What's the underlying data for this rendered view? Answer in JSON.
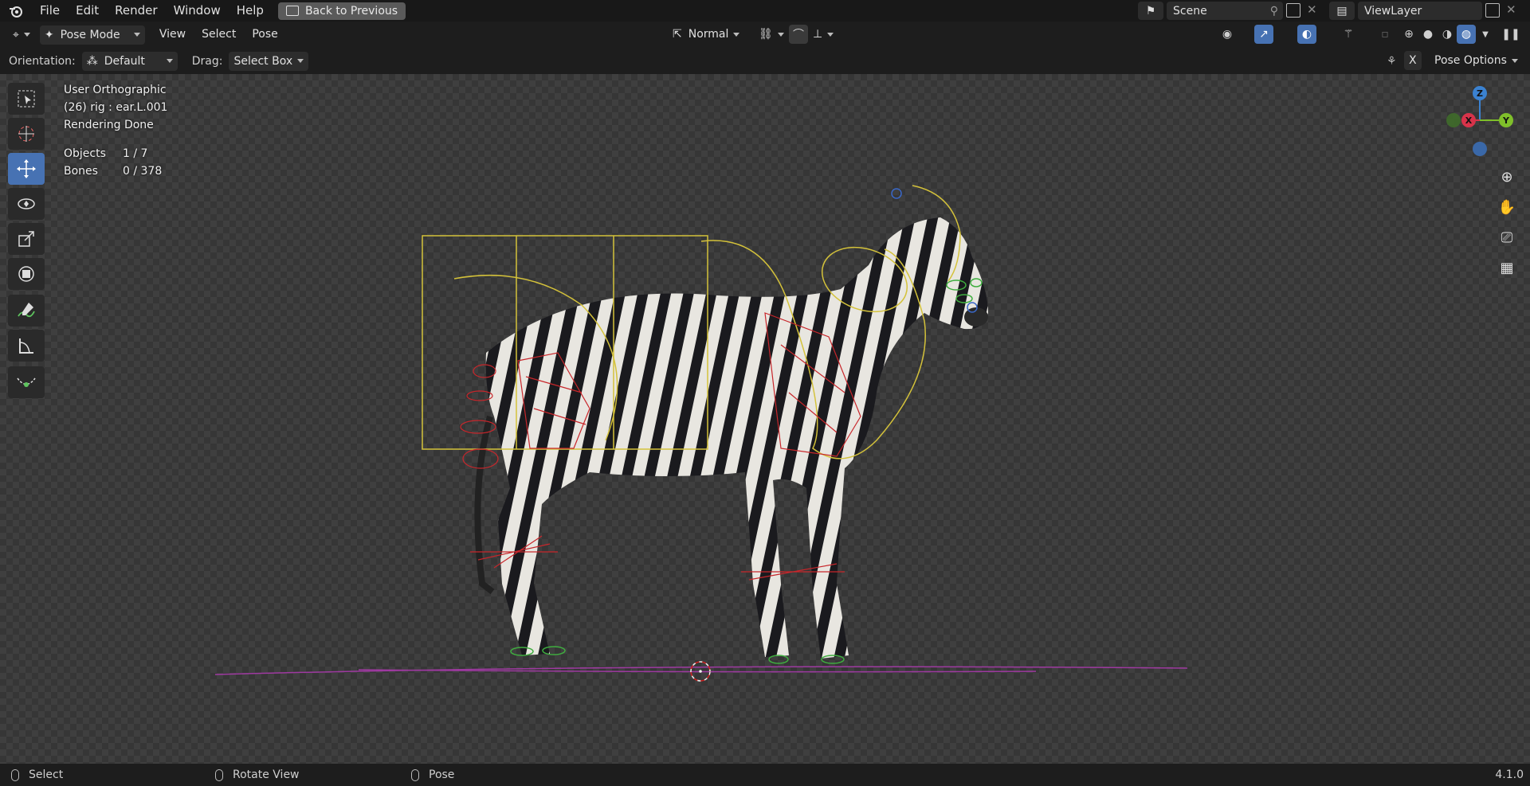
{
  "app": {
    "version": "4.1.0"
  },
  "menu": [
    "File",
    "Edit",
    "Render",
    "Window",
    "Help"
  ],
  "back_button": "Back to Previous",
  "scene": {
    "name": "Scene",
    "view_layer": "ViewLayer"
  },
  "header": {
    "mode": "Pose Mode",
    "menus": [
      "View",
      "Select",
      "Pose"
    ],
    "pivot": "Normal"
  },
  "tool_settings": {
    "orientation_label": "Orientation:",
    "orientation_value": "Default",
    "drag_label": "Drag:",
    "drag_value": "Select Box",
    "x_mirror": "X",
    "pose_options": "Pose Options"
  },
  "overlay_info": {
    "view": "User Orthographic",
    "active": "(26) rig : ear.L.001",
    "status": "Rendering Done",
    "objects_label": "Objects",
    "objects_value": "1 / 7",
    "bones_label": "Bones",
    "bones_value": "0 / 378"
  },
  "gizmo": {
    "z": "Z",
    "x": "X",
    "y": "Y"
  },
  "statusbar": {
    "left": "Select",
    "middle": "Rotate View",
    "right": "Pose"
  },
  "colors": {
    "accent": "#4772b3",
    "rig_yellow": "#d4c23a",
    "rig_red": "#c8262b",
    "rig_green": "#3fae3f",
    "ground_purple": "#b03ab3"
  },
  "icons": [
    "blender-logo-icon",
    "select-box-icon",
    "cursor-icon",
    "move-icon",
    "rotate-icon",
    "scale-icon",
    "transform-icon",
    "annotate-icon",
    "measure-icon",
    "bone-envelope-icon",
    "zoom-icon",
    "hand-icon",
    "camera-icon",
    "grid-icon"
  ]
}
